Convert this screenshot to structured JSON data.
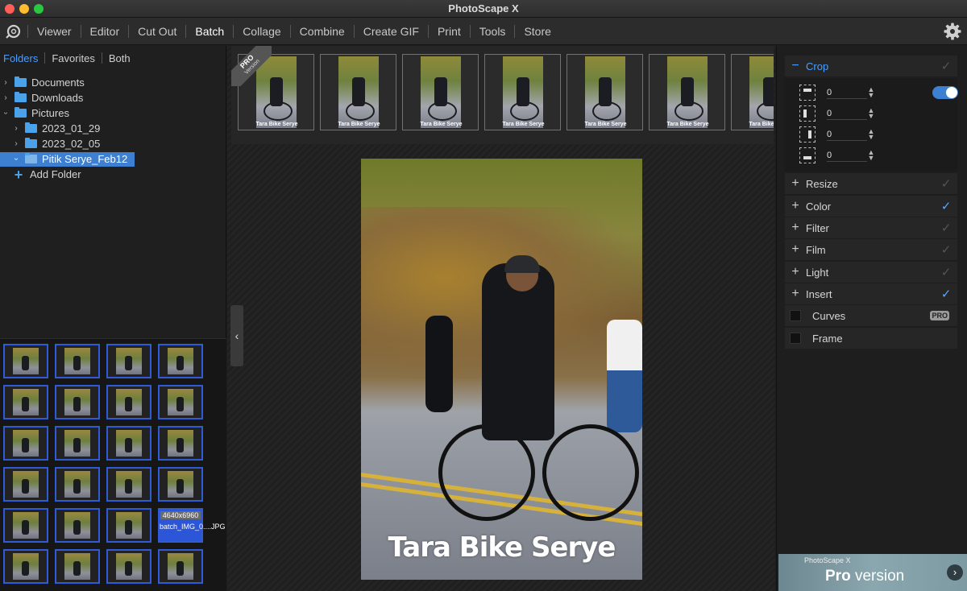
{
  "window": {
    "title": "PhotoScape X"
  },
  "menu": {
    "items": [
      "Viewer",
      "Editor",
      "Cut Out",
      "Batch",
      "Collage",
      "Combine",
      "Create GIF",
      "Print",
      "Tools",
      "Store"
    ],
    "active": "Batch"
  },
  "left_tabs": [
    "Folders",
    "Favorites",
    "Both"
  ],
  "tree": {
    "documents": "Documents",
    "downloads": "Downloads",
    "pictures": "Pictures",
    "sub1": "2023_01_29",
    "sub2": "2023_02_05",
    "selected": "Pitik Serye_Feb12",
    "add_folder": "Add Folder"
  },
  "grid_info": {
    "dimensions": "4640x6960",
    "filename": "batch_IMG_0....JPG"
  },
  "strip": {
    "ribbon_title": "PRO",
    "ribbon_sub": "Version",
    "caption": "Tara Bike Serye"
  },
  "preview": {
    "watermark": "Tara Bike Serye"
  },
  "panel": {
    "crop": {
      "label": "Crop",
      "values": [
        "0",
        "0",
        "0",
        "0"
      ],
      "enabled": true
    },
    "rows": [
      {
        "label": "Resize",
        "checked": false
      },
      {
        "label": "Color",
        "checked": true
      },
      {
        "label": "Filter",
        "checked": false
      },
      {
        "label": "Film",
        "checked": false
      },
      {
        "label": "Light",
        "checked": false
      },
      {
        "label": "Insert",
        "checked": true
      }
    ],
    "curves": "Curves",
    "curves_badge": "PRO",
    "frame": "Frame"
  },
  "pro_banner": {
    "small": "PhotoScape X",
    "big_bold": "Pro",
    "big_rest": " version"
  },
  "colors": {
    "accent": "#4a9eff",
    "selection": "#3d7fd1",
    "thumb_border": "#2f5bd6"
  }
}
